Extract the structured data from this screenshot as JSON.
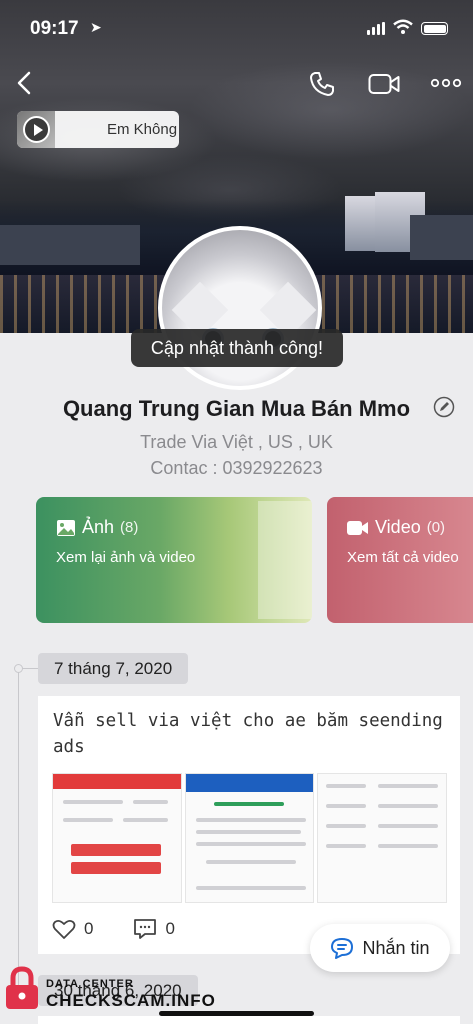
{
  "status_bar": {
    "time": "09:17"
  },
  "cover": {
    "music_title": "Em Không"
  },
  "toast": "Cập nhật thành công!",
  "profile": {
    "name": "Quang Trung Gian Mua Bán Mmo",
    "bio_line1": "Trade Via Việt , US , UK",
    "bio_line2": "Contac : 0392922623"
  },
  "albums": {
    "photos": {
      "title": "Ảnh",
      "count": "(8)",
      "subtitle": "Xem lại ảnh và video"
    },
    "videos": {
      "title": "Video",
      "count": "(0)",
      "subtitle": "Xem tất cả video"
    }
  },
  "timeline": [
    {
      "date": "7 tháng 7, 2020",
      "text": "Vẫn sell via việt cho ae băm seending ads",
      "likes": "0",
      "comments": "0"
    },
    {
      "date": "30 tháng 6, 2020"
    }
  ],
  "chat_button": "Nhắn tin",
  "watermark": {
    "line1": "DATA CENTER",
    "line2": "CHECKSCAM.INFO"
  },
  "colors": {
    "photo_card": "#4f9a63",
    "video_card": "#cf7480",
    "accent_blue": "#1d6fd6"
  }
}
